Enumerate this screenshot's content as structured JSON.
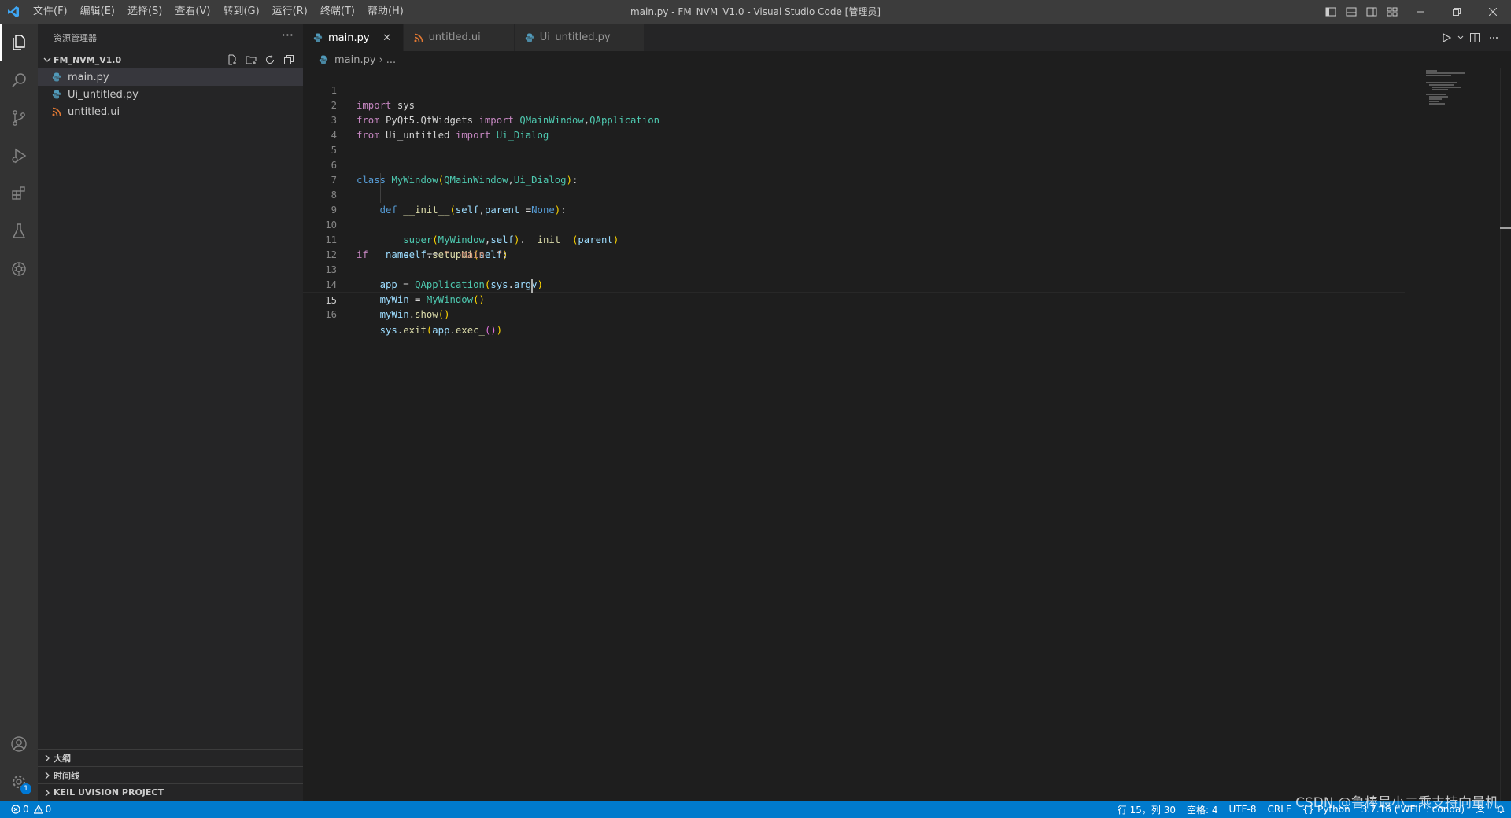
{
  "titlebar": {
    "menus": [
      "文件(F)",
      "编辑(E)",
      "选择(S)",
      "查看(V)",
      "转到(G)",
      "运行(R)",
      "终端(T)",
      "帮助(H)"
    ],
    "window_title": "main.py - FM_NVM_V1.0 - Visual Studio Code [管理员]"
  },
  "activitybar": {
    "items": [
      "explorer-icon",
      "search-icon",
      "source-control-icon",
      "run-debug-icon",
      "extensions-icon",
      "testing-icon",
      "openai-icon"
    ],
    "bottom": [
      "account-icon",
      "settings-gear-icon"
    ],
    "settings_badge": "1"
  },
  "sidebar": {
    "title": "资源管理器",
    "more": "···",
    "folder": "FM_NVM_V1.0",
    "files": [
      {
        "name": "main.py",
        "icon": "python-file-icon"
      },
      {
        "name": "Ui_untitled.py",
        "icon": "python-file-icon"
      },
      {
        "name": "untitled.ui",
        "icon": "rss-file-icon"
      }
    ],
    "panels": [
      "大纲",
      "时间线",
      "KEIL UVISION PROJECT"
    ]
  },
  "tabs": [
    {
      "label": "main.py",
      "icon": "python-file-icon",
      "active": true,
      "close": "✕"
    },
    {
      "label": "untitled.ui",
      "icon": "rss-file-icon",
      "active": false
    },
    {
      "label": "Ui_untitled.py",
      "icon": "python-file-icon",
      "active": false
    }
  ],
  "breadcrumb": {
    "file": "main.py",
    "sep": "›",
    "rest": "..."
  },
  "editor": {
    "current_line": 15,
    "line_numbers": [
      "1",
      "2",
      "3",
      "4",
      "5",
      "6",
      "7",
      "8",
      "9",
      "10",
      "11",
      "12",
      "13",
      "14",
      "15",
      "16"
    ]
  },
  "colors": {
    "accent": "#007acc",
    "keyword": "#c586c0",
    "builtin_keyword": "#569cd6",
    "class": "#4ec9b0",
    "function": "#dcdcaa",
    "variable": "#9cdcfe",
    "string": "#ce9178"
  },
  "statusbar": {
    "errors": "0",
    "warnings": "0",
    "position": "行 15，列 30",
    "spaces": "空格: 4",
    "encoding": "UTF-8",
    "eol": "CRLF",
    "language": "Python",
    "interpreter": "3.7.16 ('WFIL': conda)"
  },
  "watermark": "CSDN @鲁棒最小二乘支持向量机"
}
